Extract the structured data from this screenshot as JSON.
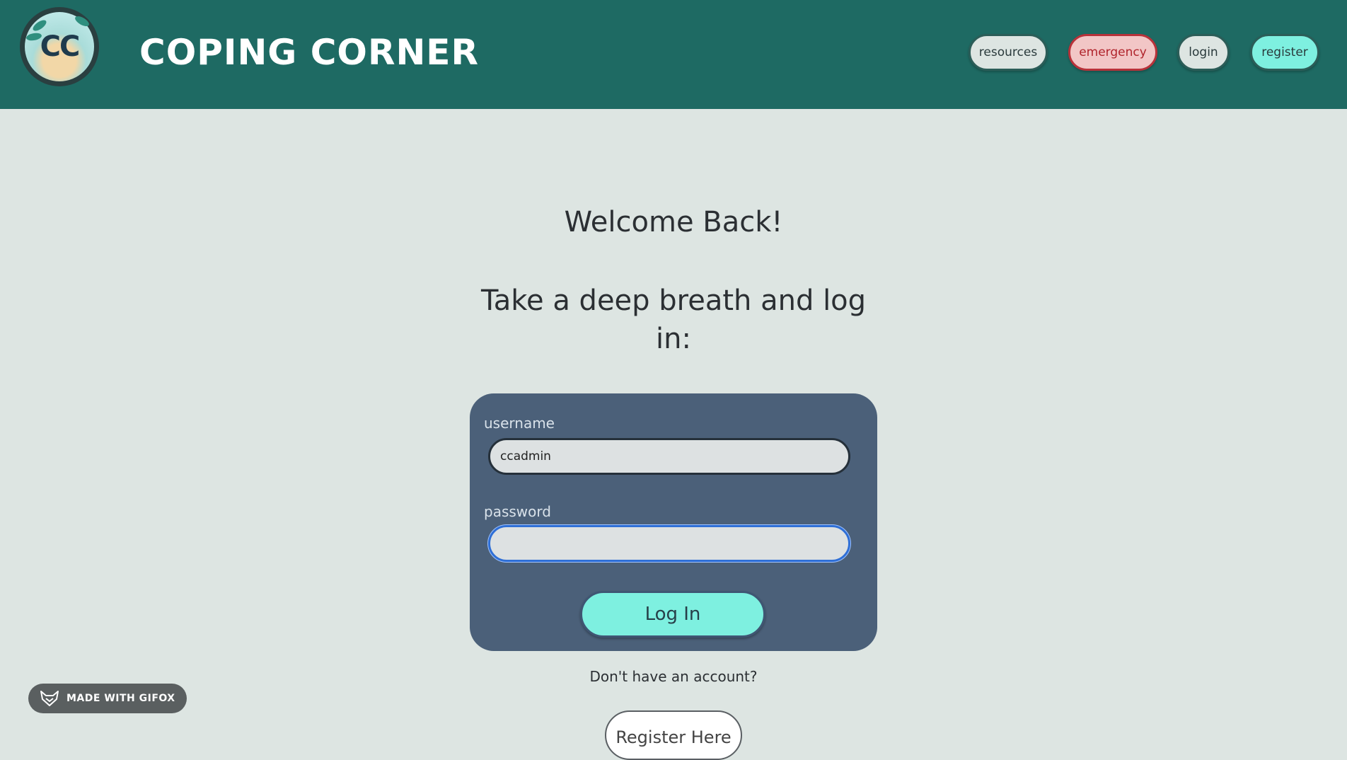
{
  "header": {
    "logo_text": "CC",
    "title": "COPING CORNER",
    "nav": {
      "resources": "resources",
      "emergency": "emergency",
      "login": "login",
      "register": "register"
    }
  },
  "main": {
    "welcome": "Welcome Back!",
    "subtitle": "Take a deep breath and log in:",
    "form": {
      "username_label": "username",
      "username_value": "ccadmin",
      "password_label": "password",
      "password_value": "",
      "submit_label": "Log In"
    },
    "no_account_text": "Don't have an account?",
    "register_here_label": "Register Here"
  },
  "watermark": {
    "text": "MADE WITH GIFOX"
  },
  "colors": {
    "header_bg": "#1e6a63",
    "page_bg": "#dde5e2",
    "card_bg": "#4b6079",
    "accent": "#7ef0e0",
    "emergency": "#b0242c"
  },
  "icons": {
    "logo": "coping-corner-logo",
    "watermark": "fox-icon"
  }
}
